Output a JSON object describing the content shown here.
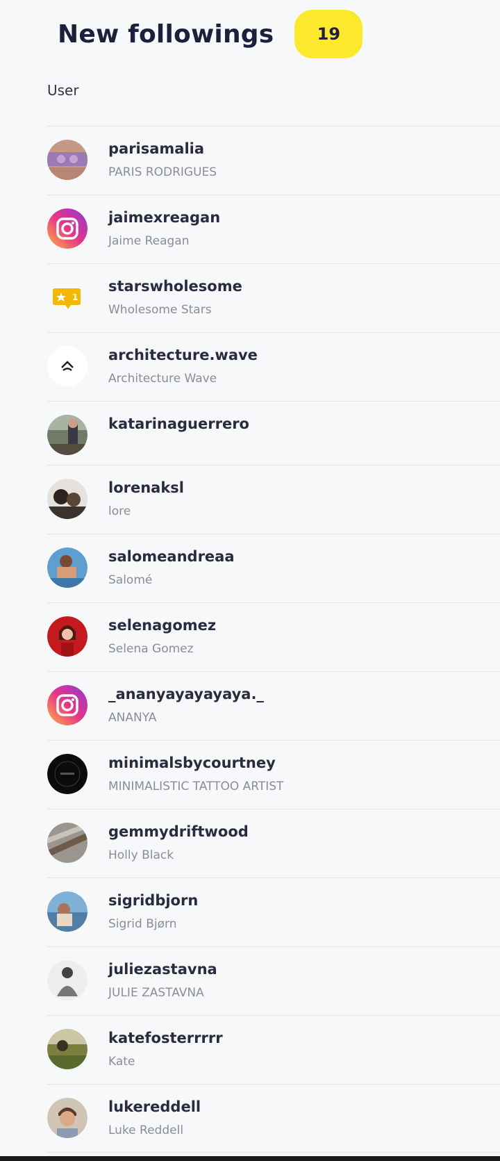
{
  "header": {
    "title": "New followings",
    "count": "19"
  },
  "table": {
    "column_user": "User"
  },
  "colors": {
    "badge_bg": "#fde92c",
    "title": "#1f1f3d",
    "subtext": "#8a8c99",
    "divider": "#e3e5ea"
  },
  "users": [
    {
      "username": "parisamalia",
      "name": "PARIS RODRIGUES",
      "avatar": "photo-avatar"
    },
    {
      "username": "jaimexreagan",
      "name": "Jaime Reagan",
      "avatar": "instagram-icon"
    },
    {
      "username": "starswholesome",
      "name": "Wholesome Stars",
      "avatar": "star-badge-icon"
    },
    {
      "username": "architecture.wave",
      "name": "Architecture Wave",
      "avatar": "wave-logo-icon"
    },
    {
      "username": "katarinaguerrero",
      "name": "",
      "avatar": "photo-avatar"
    },
    {
      "username": "lorenaksl",
      "name": "lore",
      "avatar": "photo-avatar"
    },
    {
      "username": "salomeandreaa",
      "name": "Salomé",
      "avatar": "photo-avatar"
    },
    {
      "username": "selenagomez",
      "name": "Selena Gomez",
      "avatar": "photo-avatar"
    },
    {
      "username": "_ananyayayayaya._",
      "name": "ANANYA",
      "avatar": "instagram-icon"
    },
    {
      "username": "minimalsbycourtney",
      "name": "MINIMALISTIC TATTOO ARTIST",
      "avatar": "photo-avatar"
    },
    {
      "username": "gemmydriftwood",
      "name": "Holly Black",
      "avatar": "photo-avatar"
    },
    {
      "username": "sigridbjorn",
      "name": "Sigrid Bjørn",
      "avatar": "photo-avatar"
    },
    {
      "username": "juliezastavna",
      "name": "JULIE ZASTAVNA",
      "avatar": "photo-avatar"
    },
    {
      "username": "katefosterrrrr",
      "name": "Kate",
      "avatar": "photo-avatar"
    },
    {
      "username": "lukereddell",
      "name": "Luke Reddell",
      "avatar": "photo-avatar"
    }
  ]
}
